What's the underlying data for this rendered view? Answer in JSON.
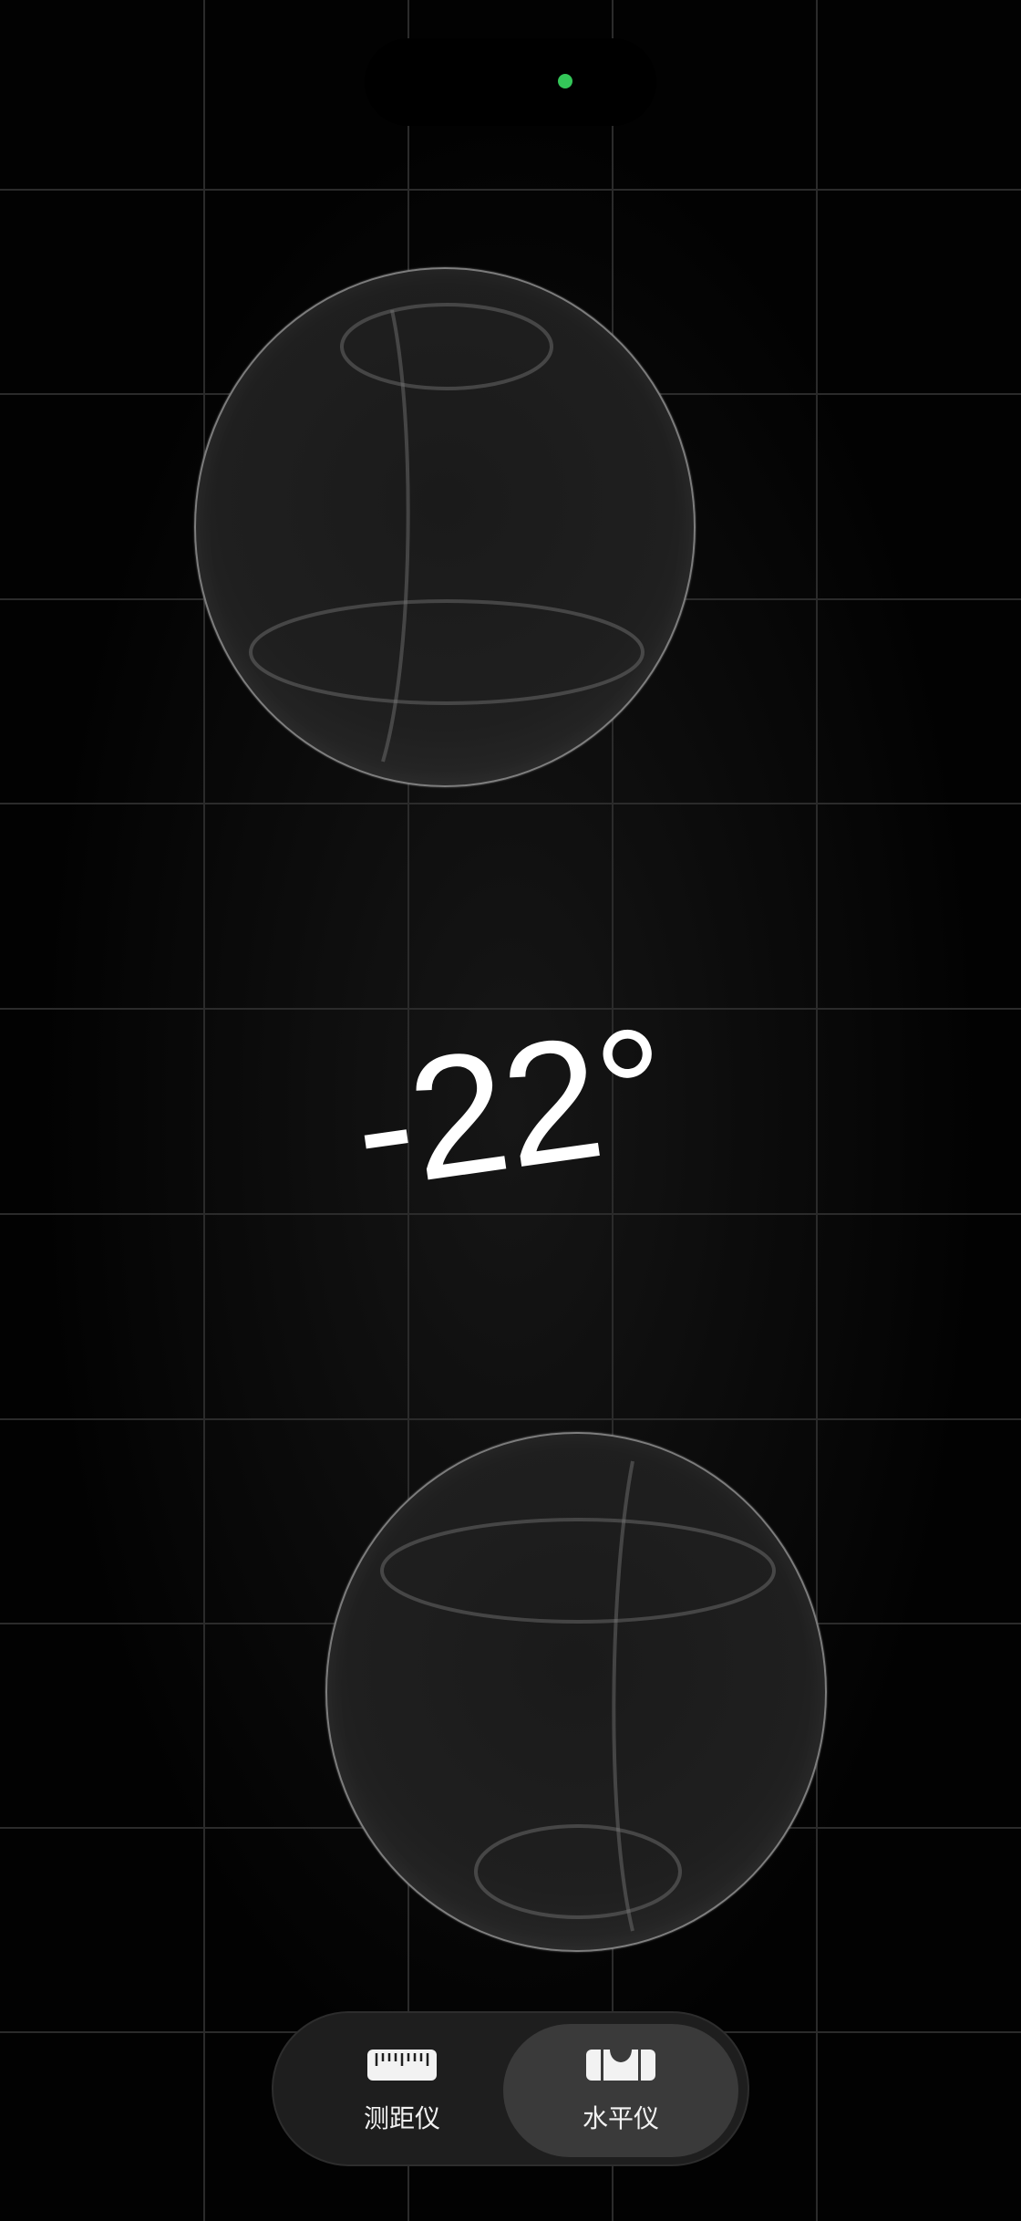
{
  "level": {
    "angle_text": "-22°"
  },
  "tabs": [
    {
      "label": "测距仪",
      "icon": "ruler-icon",
      "selected": false
    },
    {
      "label": "水平仪",
      "icon": "level-icon",
      "selected": true
    }
  ],
  "colors": {
    "background": "#000000",
    "camera_indicator": "#34c759",
    "selected_tab": "#3a3a3a",
    "tab_bar": "#1e1e1e"
  }
}
